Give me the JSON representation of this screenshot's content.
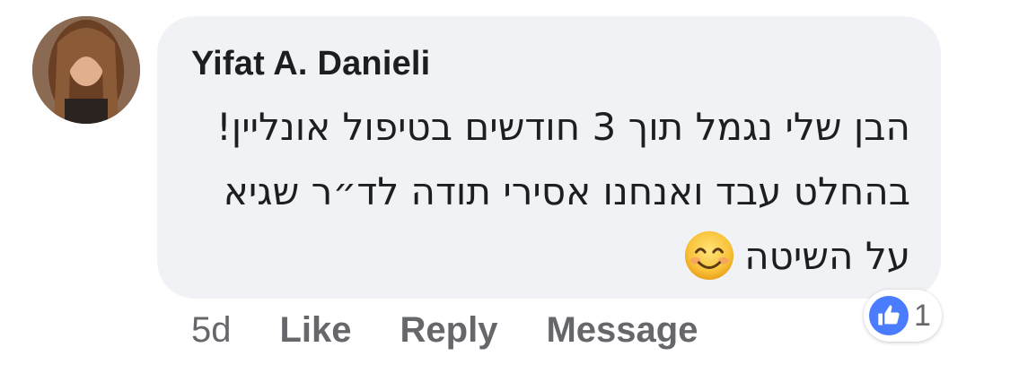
{
  "comment": {
    "author": "Yifat A. Danieli",
    "message": "הבן שלי נגמל תוך 3 חודשים בטיפול אונליין! בהחלט עבד ואנחנו אסירי תודה לד״ר שגיא על השיטה",
    "emoji": "smiling-face-icon",
    "timestamp": "5d",
    "actions": {
      "like": "Like",
      "reply": "Reply",
      "message": "Message"
    },
    "reactions": {
      "icon": "thumbs-up-icon",
      "count": "1"
    }
  },
  "colors": {
    "bubble": "#f0f2f5",
    "like_blue": "#4a7cff",
    "secondary_text": "#65676b"
  }
}
